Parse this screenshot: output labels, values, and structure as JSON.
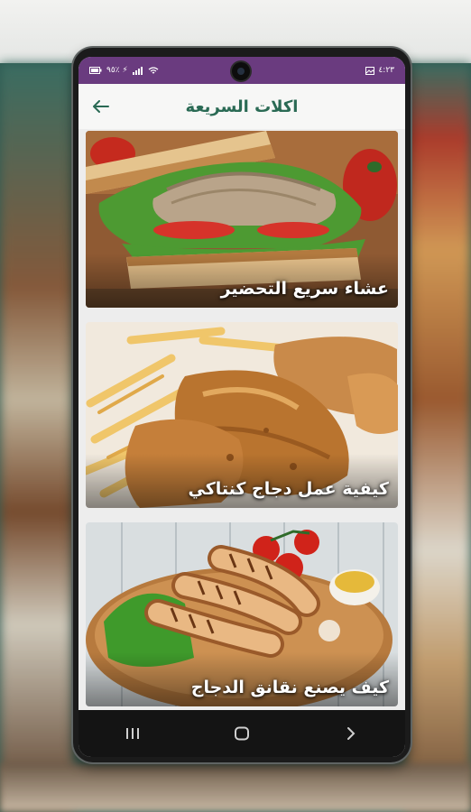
{
  "app": {
    "title": "اكلات السريعة"
  },
  "status_bar": {
    "left_text": "٩٥٪ ⚡",
    "time": "٤:٢٣"
  },
  "header": {
    "back_icon": "arrow-left-icon"
  },
  "recipes": [
    {
      "title": "عشاء سريع التحضير",
      "image": "tuna-sandwich"
    },
    {
      "title": "كيفية عمل دجاج كنتاكي",
      "image": "fried-chicken-fries"
    },
    {
      "title": "كيف يصنع نقانق الدجاج",
      "image": "sausages-tomatoes"
    }
  ],
  "nav": {
    "recent_icon": "recent-apps-icon",
    "home_icon": "home-icon",
    "back_icon": "back-chevron-icon"
  },
  "colors": {
    "status_bar": "#6a3b7f",
    "title_text": "#2a6a54",
    "nav_bar": "#141414"
  }
}
